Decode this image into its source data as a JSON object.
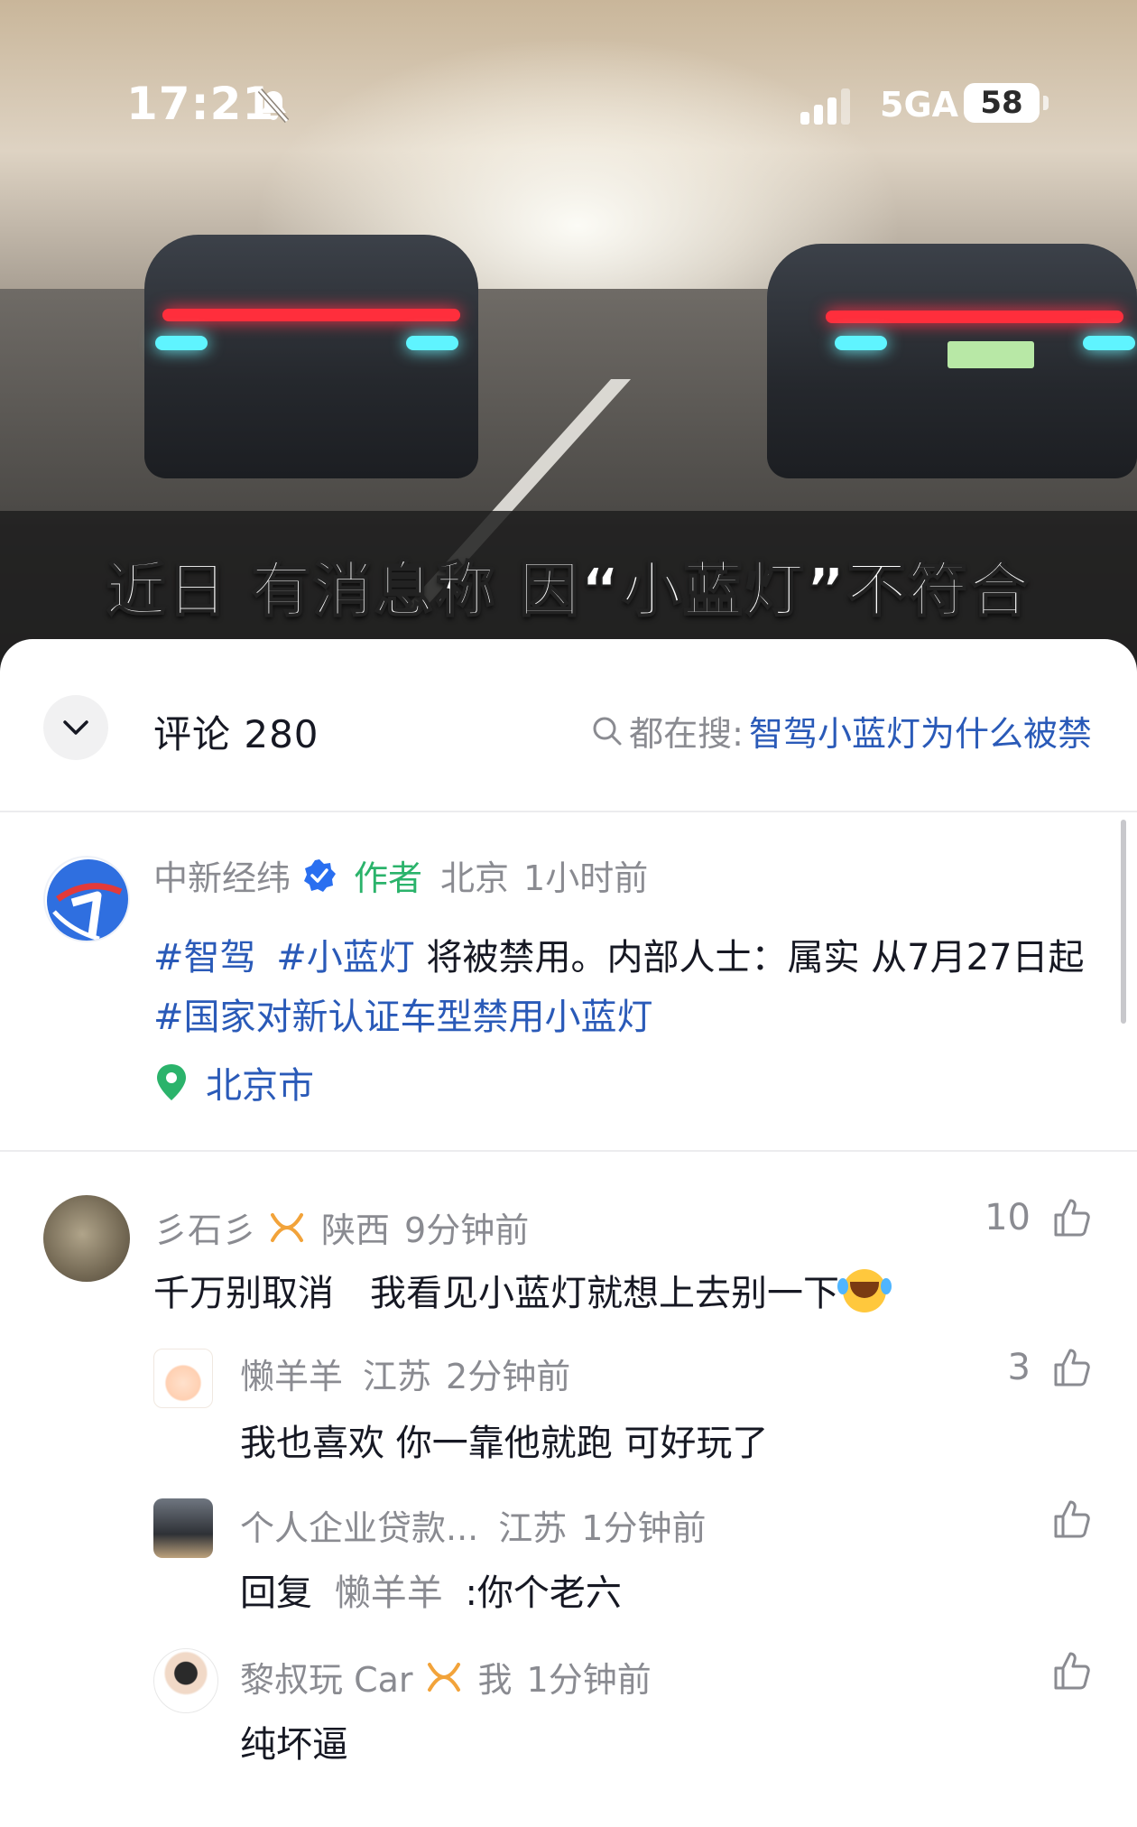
{
  "status_bar": {
    "time": "17:21",
    "network": "5GA",
    "battery": "58"
  },
  "video": {
    "caption": "近日 有消息称 因“小蓝灯”不符合"
  },
  "comments_header": {
    "title": "评论 280",
    "search_prefix": "都在搜:",
    "search_query": "智驾小蓝灯为什么被禁"
  },
  "post": {
    "author": "中新经纬",
    "author_tag": "作者",
    "region": "北京",
    "time": "1小时前",
    "tag1": "#智驾",
    "tag2": "#小蓝灯",
    "text1": " 将被禁用。内部人士：属实 从7月27日起",
    "tag3": "#国家对新认证车型禁用小蓝灯",
    "location": "北京市"
  },
  "comments": [
    {
      "name": "彡石彡",
      "region": "陕西",
      "time": "9分钟前",
      "likes": "10",
      "text": "千万别取消　我看见小蓝灯就想上去别一下"
    },
    {
      "name": "懒羊羊",
      "region": "江苏",
      "time": "2分钟前",
      "likes": "3",
      "text": "我也喜欢 你一靠他就跑 可好玩了"
    },
    {
      "name": "个人企业贷款...",
      "region": "江苏",
      "time": "1分钟前",
      "reply_prefix": "回复",
      "reply_to": "懒羊羊",
      "text": ":你个老六"
    },
    {
      "name": "黎叔玩 Car",
      "region": "我",
      "time": "1分钟前",
      "text": "纯坏逼"
    }
  ],
  "colors": {
    "accent_blue": "#2a5ab8",
    "author_green": "#2bb36b",
    "meta_gray": "#8a8b91",
    "fan_badge": "#f2a33a"
  }
}
